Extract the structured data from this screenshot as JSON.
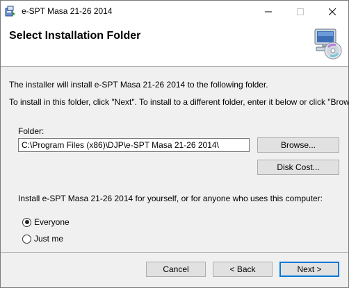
{
  "window": {
    "title": "e-SPT Masa 21-26 2014",
    "icon": "installer-icon",
    "controls": {
      "minimize": "minimize-icon",
      "maximize": "maximize-icon",
      "close": "close-icon"
    }
  },
  "header": {
    "title": "Select Installation Folder",
    "graphic": "computer-cd-icon"
  },
  "body": {
    "line1": "The installer will install e-SPT Masa 21-26 2014 to the following folder.",
    "line2": "To install in this folder, click \"Next\". To install to a different folder, enter it below or click \"Browse\"."
  },
  "folder": {
    "label": "Folder:",
    "value": "C:\\Program Files (x86)\\DJP\\e-SPT Masa 21-26 2014\\",
    "browse_label": "Browse...",
    "disk_cost_label": "Disk Cost..."
  },
  "install_for": {
    "prompt": "Install e-SPT Masa 21-26 2014 for yourself, or for anyone who uses this computer:",
    "options": [
      {
        "label": "Everyone",
        "selected": true
      },
      {
        "label": "Just me",
        "selected": false
      }
    ]
  },
  "footer": {
    "cancel_label": "Cancel",
    "back_label": "< Back",
    "next_label": "Next >"
  },
  "colors": {
    "accent": "#0078d7",
    "button_bg": "#e1e1e1",
    "dialog_bg": "#f0f0f0"
  }
}
